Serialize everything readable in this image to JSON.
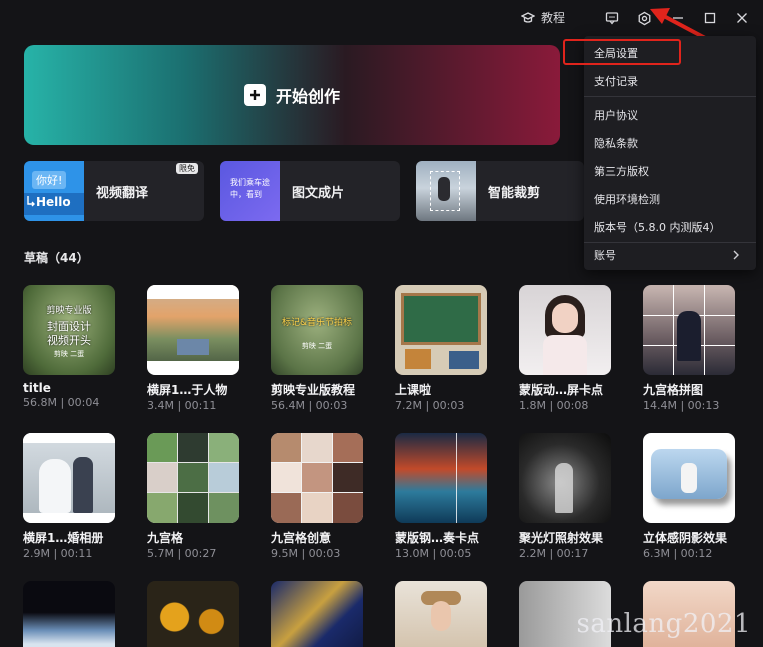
{
  "topbar": {
    "tutorial_label": "教程"
  },
  "hero": {
    "label": "开始创作"
  },
  "tools": [
    {
      "name": "视频翻译",
      "badge": "限免",
      "thumb_texts": [
        "你好!",
        "Hello"
      ]
    },
    {
      "name": "图文成片",
      "thumb_texts": [
        "我们乘车途中，看到"
      ]
    },
    {
      "name": "智能裁剪"
    }
  ],
  "drafts": {
    "label": "草稿（44）"
  },
  "cards": [
    {
      "title": "title",
      "meta": "56.8M | 00:04",
      "thumb_texts": [
        "剪映专业版",
        "封面设计",
        "视频开头",
        "剪映 二蛋"
      ]
    },
    {
      "title": "横屏1…于人物",
      "meta": "3.4M | 00:11"
    },
    {
      "title": "剪映专业版教程",
      "meta": "56.4M | 00:03",
      "thumb_texts": [
        "标记&音乐节拍标",
        "剪映 二蛋"
      ]
    },
    {
      "title": "上课啦",
      "meta": "7.2M | 00:03"
    },
    {
      "title": "蒙版动…屏卡点",
      "meta": "1.8M | 00:08"
    },
    {
      "title": "九宫格拼图",
      "meta": "14.4M | 00:13"
    },
    {
      "title": "横屏1…婚相册",
      "meta": "2.9M | 00:11"
    },
    {
      "title": "九宫格",
      "meta": "5.7M | 00:27"
    },
    {
      "title": "九宫格创意",
      "meta": "9.5M | 00:03"
    },
    {
      "title": "蒙版钢…奏卡点",
      "meta": "13.0M | 00:05"
    },
    {
      "title": "聚光灯照射效果",
      "meta": "2.2M | 00:17"
    },
    {
      "title": "立体感阴影效果",
      "meta": "6.3M | 00:12"
    }
  ],
  "menu": {
    "items": [
      "全局设置",
      "支付记录",
      "用户协议",
      "隐私条款",
      "第三方版权",
      "使用环境检测",
      "版本号（5.8.0 内测版4）",
      "账号"
    ]
  },
  "watermark": "sanlang2021",
  "colors": {
    "highlight": "#e0241c",
    "background": "#141417",
    "menu_bg": "#1e1e22"
  }
}
